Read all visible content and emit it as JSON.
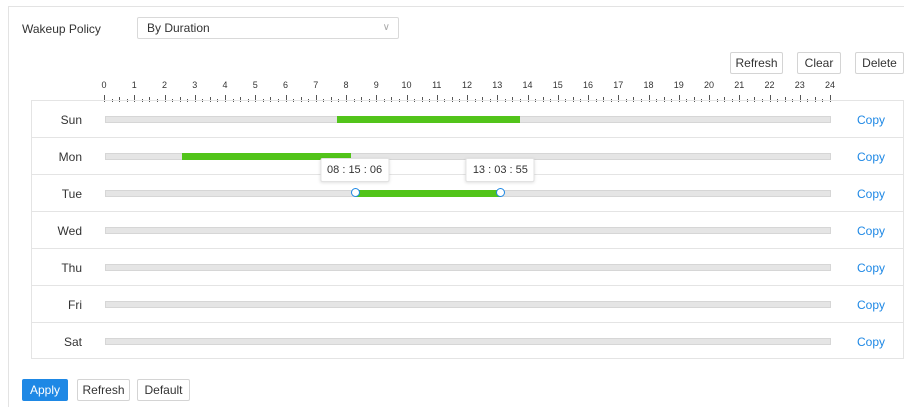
{
  "policy": {
    "label": "Wakeup Policy",
    "value": "By Duration"
  },
  "toolbar": {
    "refresh": "Refresh",
    "clear": "Clear",
    "delete": "Delete"
  },
  "hours": [
    "0",
    "1",
    "2",
    "3",
    "4",
    "5",
    "6",
    "7",
    "8",
    "9",
    "10",
    "11",
    "12",
    "13",
    "14",
    "15",
    "16",
    "17",
    "18",
    "19",
    "20",
    "21",
    "22",
    "23",
    "24"
  ],
  "copy_label": "Copy",
  "days": [
    {
      "name": "Sun",
      "segments": [
        {
          "start": 7.65,
          "end": 13.7
        }
      ]
    },
    {
      "name": "Mon",
      "segments": [
        {
          "start": 2.5,
          "end": 8.1
        }
      ]
    },
    {
      "name": "Tue",
      "segments": [
        {
          "start": 8.25,
          "end": 13.07
        }
      ],
      "editing": true,
      "start_time": [
        "08",
        "15",
        "06"
      ],
      "end_time": [
        "13",
        "03",
        "55"
      ]
    },
    {
      "name": "Wed",
      "segments": []
    },
    {
      "name": "Thu",
      "segments": []
    },
    {
      "name": "Fri",
      "segments": []
    },
    {
      "name": "Sat",
      "segments": []
    }
  ],
  "colors": {
    "segment": "#52c41a",
    "accent": "#1e88e5"
  },
  "footer": {
    "apply": "Apply",
    "refresh": "Refresh",
    "default": "Default"
  }
}
